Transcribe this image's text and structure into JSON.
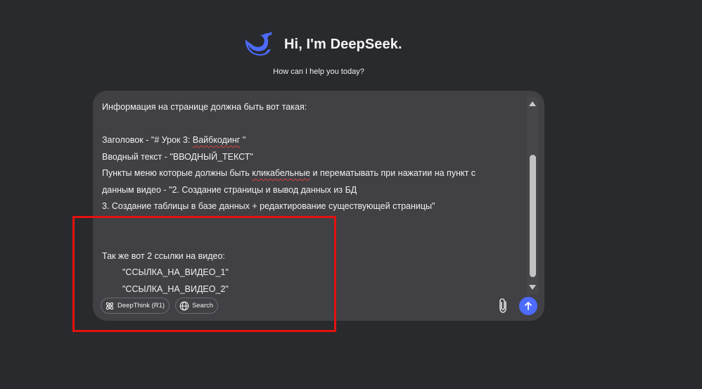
{
  "hero": {
    "title": "Hi, I'm DeepSeek.",
    "subtitle": "How can I help you today?",
    "logo_icon": "deepseek-whale-icon"
  },
  "composer": {
    "lines": [
      "Информация на странице должна быть вот такая:",
      "",
      "Заголовок - \"# Урок 3: Вайбкодинг \"",
      "Вводный текст - \"ВВОДНЫЙ_ТЕКСТ\"",
      "Пункты меню которые должны быть кликабельные и перематывать при нажатии на пункт с",
      "данным видео - \"2. Создание страницы и вывод данных из БД",
      "3. Создание таблицы в базе данных + редактирование существующей страницы\"",
      "",
      "",
      "Так же вот 2 ссылки на видео:",
      "\"ССЫЛКА_НА_ВИДЕО_1\"",
      "\"ССЫЛКА_НА_ВИДЕО_2\""
    ],
    "deepthink_label": "DeepThink (R1)",
    "search_label": "Search",
    "icons": {
      "deepthink": "atom-icon",
      "search": "globe-icon",
      "attach": "paperclip-icon",
      "send": "arrow-up-icon"
    }
  },
  "colors": {
    "background": "#292a2d",
    "composer": "#404045",
    "accent": "#4d6bfe",
    "highlight": "#e3120f"
  }
}
